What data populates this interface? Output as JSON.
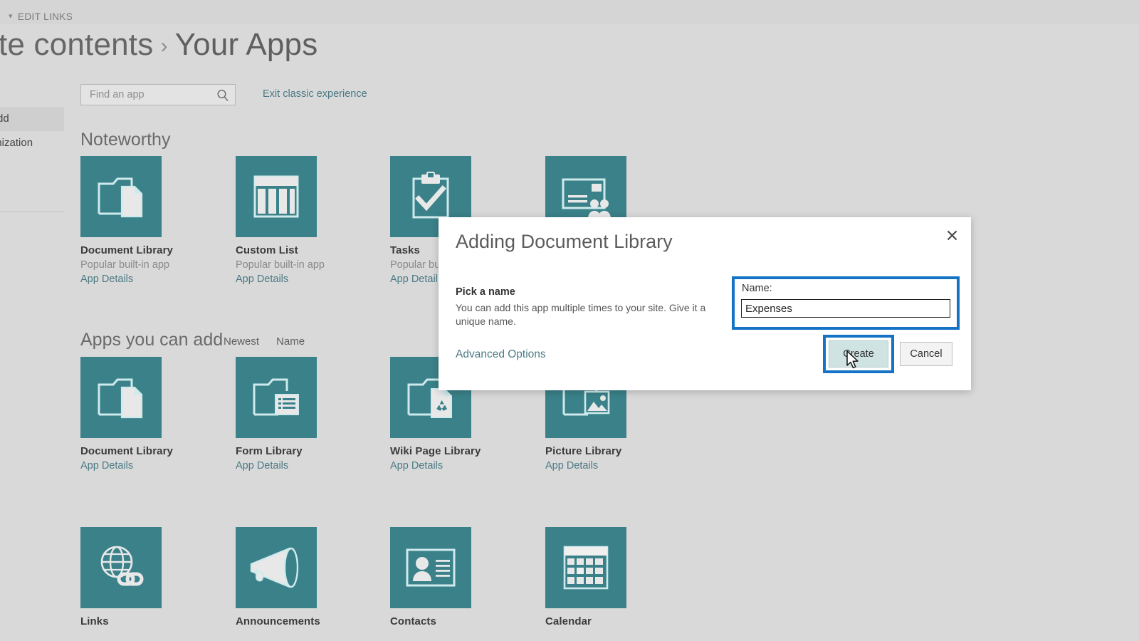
{
  "topbar": {
    "edit_links_label": "EDIT LINKS",
    "caret_icon": "chevron-down-icon"
  },
  "breadcrumb": {
    "parent": "ite contents",
    "separator": "›",
    "current": "Your Apps"
  },
  "leftnav": {
    "items": [
      {
        "label": "Add",
        "selected": true
      },
      {
        "label": "anization",
        "selected": false
      }
    ]
  },
  "search": {
    "placeholder": "Find an app",
    "value": "",
    "icon": "search-icon"
  },
  "links": {
    "exit_classic": "Exit classic experience"
  },
  "sections": {
    "noteworthy": {
      "title": "Noteworthy"
    },
    "apps_you_can_add": {
      "title": "Apps you can add",
      "sort": [
        "Newest",
        "Name"
      ]
    }
  },
  "details_label": "App Details",
  "noteworthy_tiles": [
    {
      "name": "Document Library",
      "sub": "Popular built-in app",
      "details": "App Details",
      "icon": "folder-document-icon"
    },
    {
      "name": "Custom List",
      "sub": "Popular built-in app",
      "details": "App Details",
      "icon": "table-columns-icon"
    },
    {
      "name": "Tasks",
      "sub": "Popular bu",
      "details": "App Detail",
      "icon": "clipboard-check-icon"
    },
    {
      "name": "",
      "sub": "",
      "details": "",
      "icon": "contacts-card-icon"
    }
  ],
  "addable_tiles": [
    {
      "name": "Document Library",
      "details": "App Details",
      "icon": "folder-document-icon"
    },
    {
      "name": "Form Library",
      "details": "App Details",
      "icon": "folder-form-icon"
    },
    {
      "name": "Wiki Page Library",
      "details": "App Details",
      "icon": "folder-wiki-icon"
    },
    {
      "name": "Picture Library",
      "details": "App Details",
      "icon": "folder-picture-icon"
    },
    {
      "name": "Links",
      "details": "",
      "icon": "globe-link-icon"
    },
    {
      "name": "Announcements",
      "details": "",
      "icon": "megaphone-icon"
    },
    {
      "name": "Contacts",
      "details": "",
      "icon": "contact-card-icon"
    },
    {
      "name": "Calendar",
      "details": "",
      "icon": "calendar-grid-icon"
    }
  ],
  "dialog": {
    "title": "Adding Document Library",
    "close_icon": "close-icon",
    "pick_name_heading": "Pick a name",
    "pick_name_description": "You can add this app multiple times to your site. Give it a unique name.",
    "advanced_options": "Advanced Options",
    "name_label": "Name:",
    "name_value": "Expenses",
    "create_button": "Create",
    "cancel_button": "Cancel",
    "cursor_icon": "mouse-pointer-icon"
  },
  "colors": {
    "tile_teal": "#3a8189",
    "page_background": "#d9d9d9",
    "link_teal": "#4b7a85",
    "highlight_blue": "#1573c6",
    "create_fill": "#cfe3e2"
  }
}
